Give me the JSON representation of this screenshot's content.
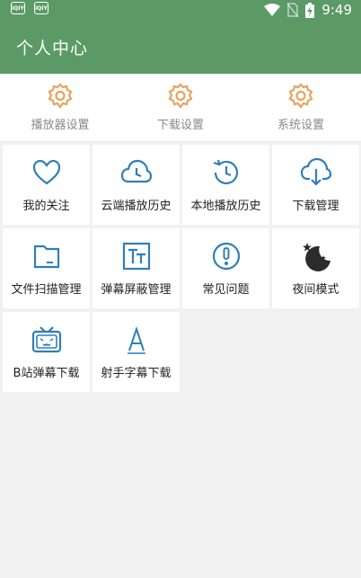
{
  "status_bar": {
    "time": "9:49",
    "left_icons": [
      "iqiyi-icon",
      "iqiyi-icon"
    ],
    "right_icons": [
      "wifi-icon",
      "no-sim-icon",
      "battery-charging-icon"
    ]
  },
  "app_bar": {
    "title": "个人中心"
  },
  "settings": [
    {
      "label": "播放器设置",
      "icon": "gear-icon"
    },
    {
      "label": "下载设置",
      "icon": "gear-icon"
    },
    {
      "label": "系统设置",
      "icon": "gear-icon"
    }
  ],
  "grid": [
    {
      "label": "我的关注",
      "icon": "heart-icon"
    },
    {
      "label": "云端播放历史",
      "icon": "cloud-clock-icon"
    },
    {
      "label": "本地播放历史",
      "icon": "history-clock-icon"
    },
    {
      "label": "下载管理",
      "icon": "cloud-download-icon"
    },
    {
      "label": "文件扫描管理",
      "icon": "folder-icon"
    },
    {
      "label": "弹幕屏蔽管理",
      "icon": "text-block-icon"
    },
    {
      "label": "常见问题",
      "icon": "exclamation-icon"
    },
    {
      "label": "夜间模式",
      "icon": "moon-stars-icon"
    },
    {
      "label": "B站弹幕下载",
      "icon": "bilibili-tv-icon"
    },
    {
      "label": "射手字幕下载",
      "icon": "letter-a-icon"
    }
  ],
  "colors": {
    "primary": "#5b9a66",
    "icon_blue": "#2f7fb8",
    "gear_orange": "#e8a25f",
    "label_gray": "#8a8a8a"
  }
}
